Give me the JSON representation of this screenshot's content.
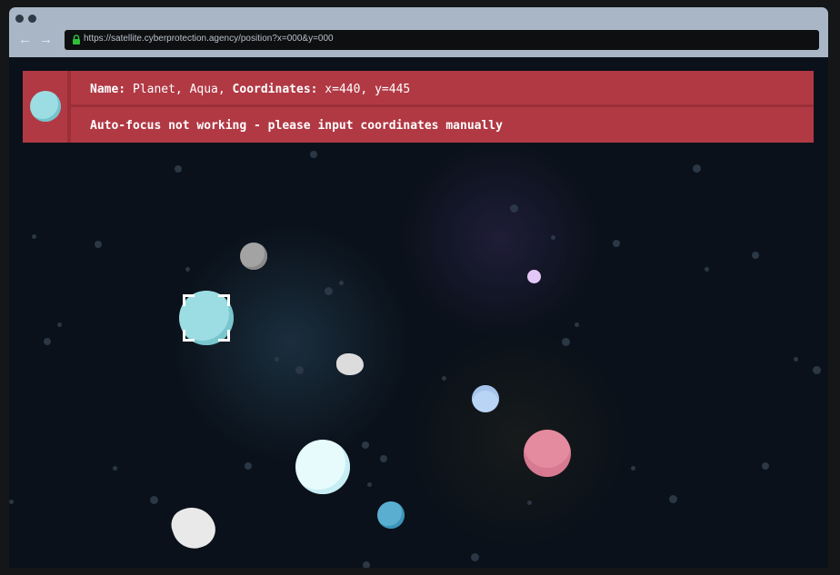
{
  "browser": {
    "url": "https://satellite.cyberprotection.agency/position?x=000&y=000",
    "back_icon": "arrow-left-icon",
    "forward_icon": "arrow-right-icon",
    "lock_icon": "lock-icon"
  },
  "info": {
    "name_label": "Name:",
    "name_value": "Planet, Aqua,",
    "coords_label": "Coordinates:",
    "coords_value": "x=440, y=445",
    "warning": "Auto-focus not working - please input coordinates manually"
  },
  "colors": {
    "banner": "#b13944",
    "space": "#0a111a",
    "aqua": "#9cdde3"
  }
}
